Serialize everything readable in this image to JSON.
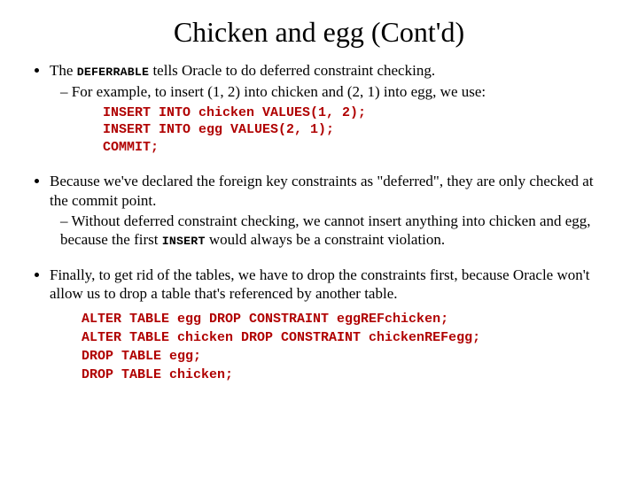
{
  "title": "Chicken and egg (Cont'd)",
  "bullets": {
    "b1": {
      "pre": "The ",
      "kw": "DEFERRABLE",
      "post": " tells Oracle to do deferred constraint checking.",
      "sub1": "For example, to insert (1, 2) into chicken and (2, 1) into egg, we use:"
    },
    "code1": "INSERT INTO chicken VALUES(1, 2);\nINSERT INTO egg VALUES(2, 1);\nCOMMIT;",
    "b2": {
      "text": "Because we've declared the foreign key constraints as \"deferred\", they are only checked at the commit point.",
      "sub1_pre": "Without deferred constraint checking, we cannot insert anything into chicken and egg, because the first ",
      "sub1_kw": "INSERT",
      "sub1_post": " would always be a constraint violation."
    },
    "b3": "Finally, to get rid of the tables, we have to drop the constraints first, because Oracle won't allow us to drop a table that's referenced by another table.",
    "code2": "ALTER TABLE egg DROP CONSTRAINT eggREFchicken;\nALTER TABLE chicken DROP CONSTRAINT chickenREFegg;\nDROP TABLE egg;\nDROP TABLE chicken;"
  }
}
